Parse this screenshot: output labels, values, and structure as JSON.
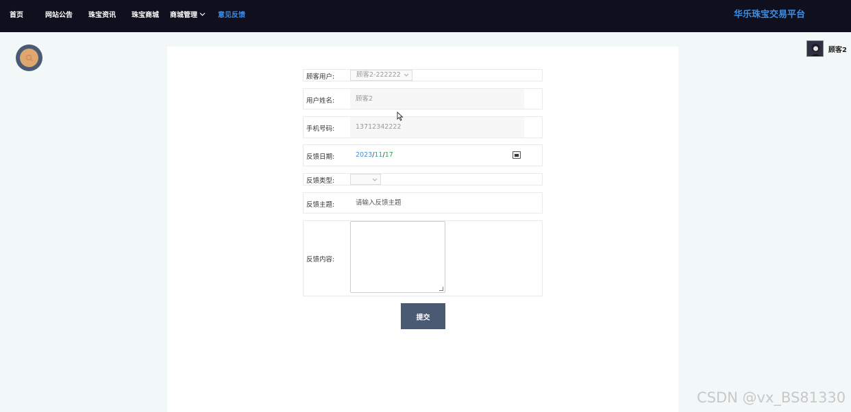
{
  "nav": {
    "items": [
      {
        "label": "首页"
      },
      {
        "label": "网站公告"
      },
      {
        "label": "珠宝资讯"
      },
      {
        "label": "珠宝商城"
      },
      {
        "label": "商城管理"
      },
      {
        "label": "意见反馈"
      }
    ],
    "brand": "华乐珠宝交易平台"
  },
  "user": {
    "name": "顾客2"
  },
  "form": {
    "customer": {
      "label": "顾客用户:",
      "value": "顾客2-222222"
    },
    "name": {
      "label": "用户姓名:",
      "value": "顾客2"
    },
    "phone": {
      "label": "手机号码:",
      "value": "13712342222"
    },
    "date": {
      "label": "反馈日期:",
      "year": "2023",
      "month": "11",
      "day": "17",
      "sep": "/"
    },
    "type": {
      "label": "反馈类型:",
      "value": ""
    },
    "subject": {
      "label": "反馈主题:",
      "placeholder": "请输入反馈主题"
    },
    "content": {
      "label": "反馈内容:",
      "value": ""
    },
    "submit_label": "提交"
  },
  "watermark": "CSDN @vx_BS81330",
  "colors": {
    "topbar": "#0f0f1e",
    "accent": "#3d8fe6",
    "button": "#4b5a73",
    "search_inner": "#e0a66f"
  }
}
